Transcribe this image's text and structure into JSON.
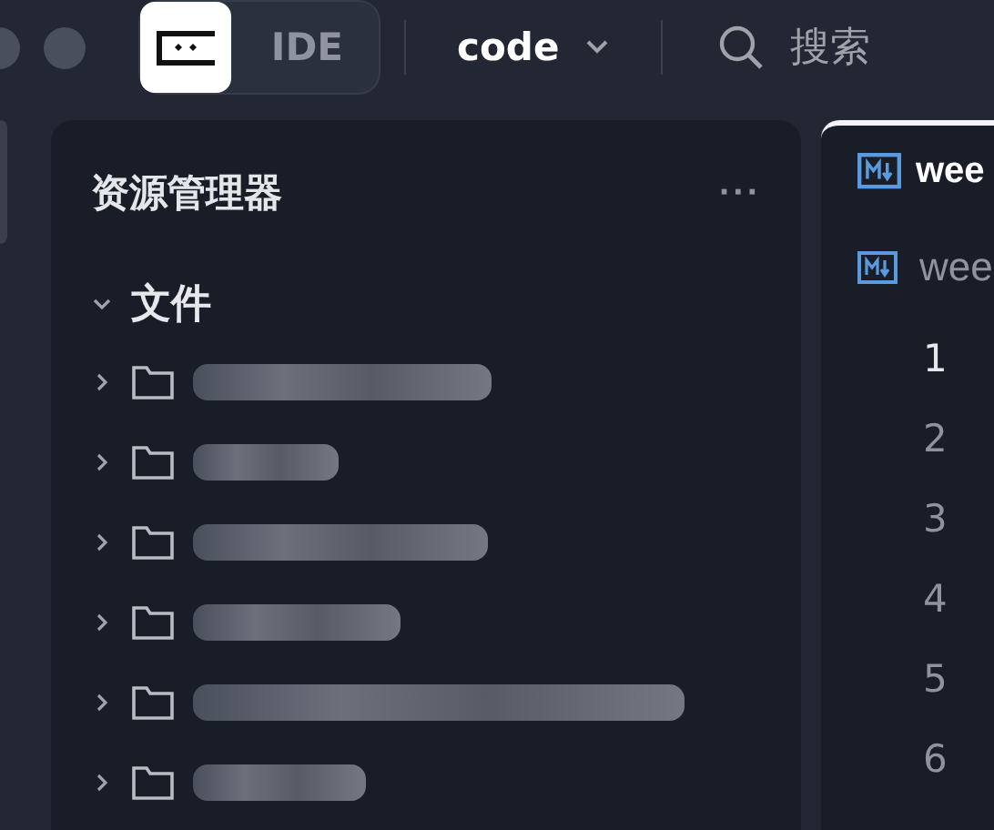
{
  "toolbar": {
    "mode_button": {
      "label": "IDE"
    },
    "project": {
      "label": "code"
    },
    "search": {
      "placeholder": "搜索"
    }
  },
  "explorer": {
    "title": "资源管理器",
    "menu": "···",
    "section": {
      "label": "文件",
      "expanded": true
    },
    "folders": [
      {
        "expanded": false
      },
      {
        "expanded": false
      },
      {
        "expanded": false
      },
      {
        "expanded": false
      },
      {
        "expanded": false
      },
      {
        "expanded": false
      }
    ]
  },
  "editor": {
    "tabs": [
      {
        "label": "wee",
        "selected": true
      }
    ],
    "breadcrumb": "wee",
    "line_numbers": [
      {
        "label": "1",
        "selected": true
      },
      {
        "label": "2",
        "selected": false
      },
      {
        "label": "3",
        "selected": false
      },
      {
        "label": "4",
        "selected": false
      },
      {
        "label": "5",
        "selected": false
      },
      {
        "label": "6",
        "selected": false
      }
    ]
  }
}
